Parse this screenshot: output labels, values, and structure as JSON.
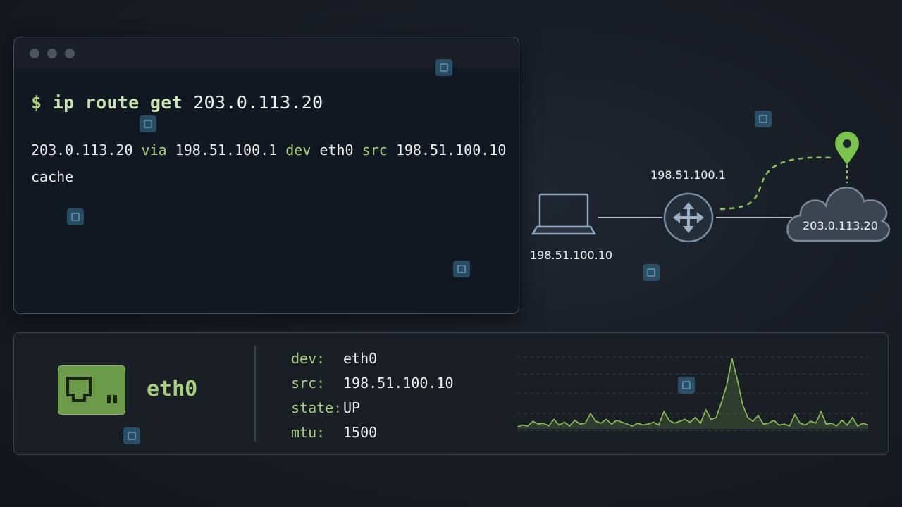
{
  "terminal": {
    "prompt": "$",
    "command": "ip route get",
    "destination": "203.0.113.20",
    "output": {
      "dest": "203.0.113.20",
      "via_kw": "via",
      "gateway": "198.51.100.1",
      "dev_kw": "dev",
      "dev": "eth0",
      "src_kw": "src",
      "src": "198.51.100.10",
      "line2": "cache"
    }
  },
  "diagram": {
    "host_ip": "198.51.100.10",
    "router_ip": "198.51.100.1",
    "cloud_ip": "203.0.113.20",
    "path_color": "#8dc35a"
  },
  "interface": {
    "name": "eth0",
    "fields": [
      {
        "key": "dev:",
        "value": "eth0"
      },
      {
        "key": "src:",
        "value": "198.51.100.10"
      },
      {
        "key": "state:",
        "value": "UP"
      },
      {
        "key": "mtu:",
        "value": "1500"
      }
    ]
  },
  "traffic_sparkline": {
    "values": [
      2,
      4,
      3,
      8,
      5,
      6,
      3,
      10,
      4,
      7,
      3,
      9,
      5,
      6,
      16,
      8,
      6,
      10,
      5,
      9,
      7,
      5,
      3,
      6,
      4,
      5,
      7,
      4,
      18,
      9,
      6,
      8,
      10,
      7,
      12,
      6,
      20,
      10,
      12,
      28,
      46,
      74,
      52,
      26,
      12,
      8,
      14,
      5,
      6,
      9,
      4,
      5,
      3,
      15,
      6,
      4,
      8,
      6,
      18,
      5,
      6,
      3,
      9,
      4,
      12,
      3,
      6,
      4
    ]
  },
  "colors": {
    "accent": "#a8cf7e",
    "nic": "#6b9a48",
    "pin": "#7cc24f"
  }
}
